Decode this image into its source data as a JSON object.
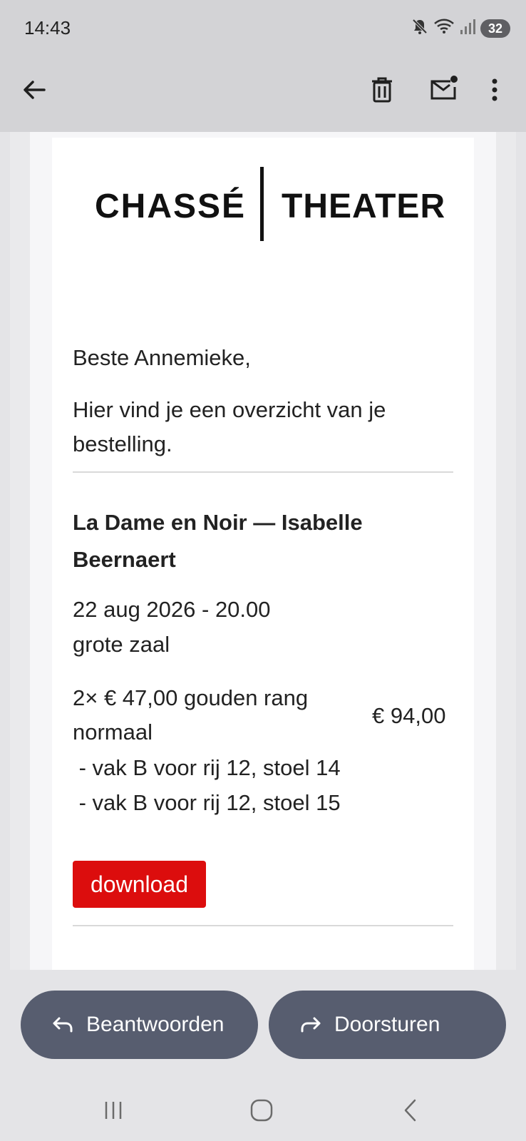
{
  "status_bar": {
    "time": "14:43",
    "battery": "32",
    "icons": [
      "mute-icon",
      "wifi-icon",
      "signal-icon",
      "battery-icon"
    ]
  },
  "toolbar": {
    "icons": [
      "back-arrow-icon",
      "trash-icon",
      "mark-unread-icon",
      "more-vert-icon"
    ]
  },
  "email": {
    "logo": {
      "left": "CHASSÉ",
      "right": "THEATER"
    },
    "greeting": "Beste Annemieke,",
    "intro": "Hier vind je een overzicht van je bestelling.",
    "show_title": "La Dame en Noir — Isabelle Beernaert",
    "date_time": "22 aug 2026 - 20.00",
    "hall": "grote zaal",
    "order_line": "2× € 47,00 gouden rang normaal",
    "order_total": "€ 94,00",
    "seats": [
      " - vak B voor rij 12, stoel 14",
      " - vak B voor rij 12, stoel 15"
    ],
    "download_label": "download",
    "accent_color": "#dc0d0d"
  },
  "actions": {
    "reply_label": "Beantwoorden",
    "forward_label": "Doorsturen",
    "button_color": "#575d6f"
  },
  "navbar": {
    "icons": [
      "recent-apps-icon",
      "home-icon",
      "nav-back-icon"
    ]
  }
}
